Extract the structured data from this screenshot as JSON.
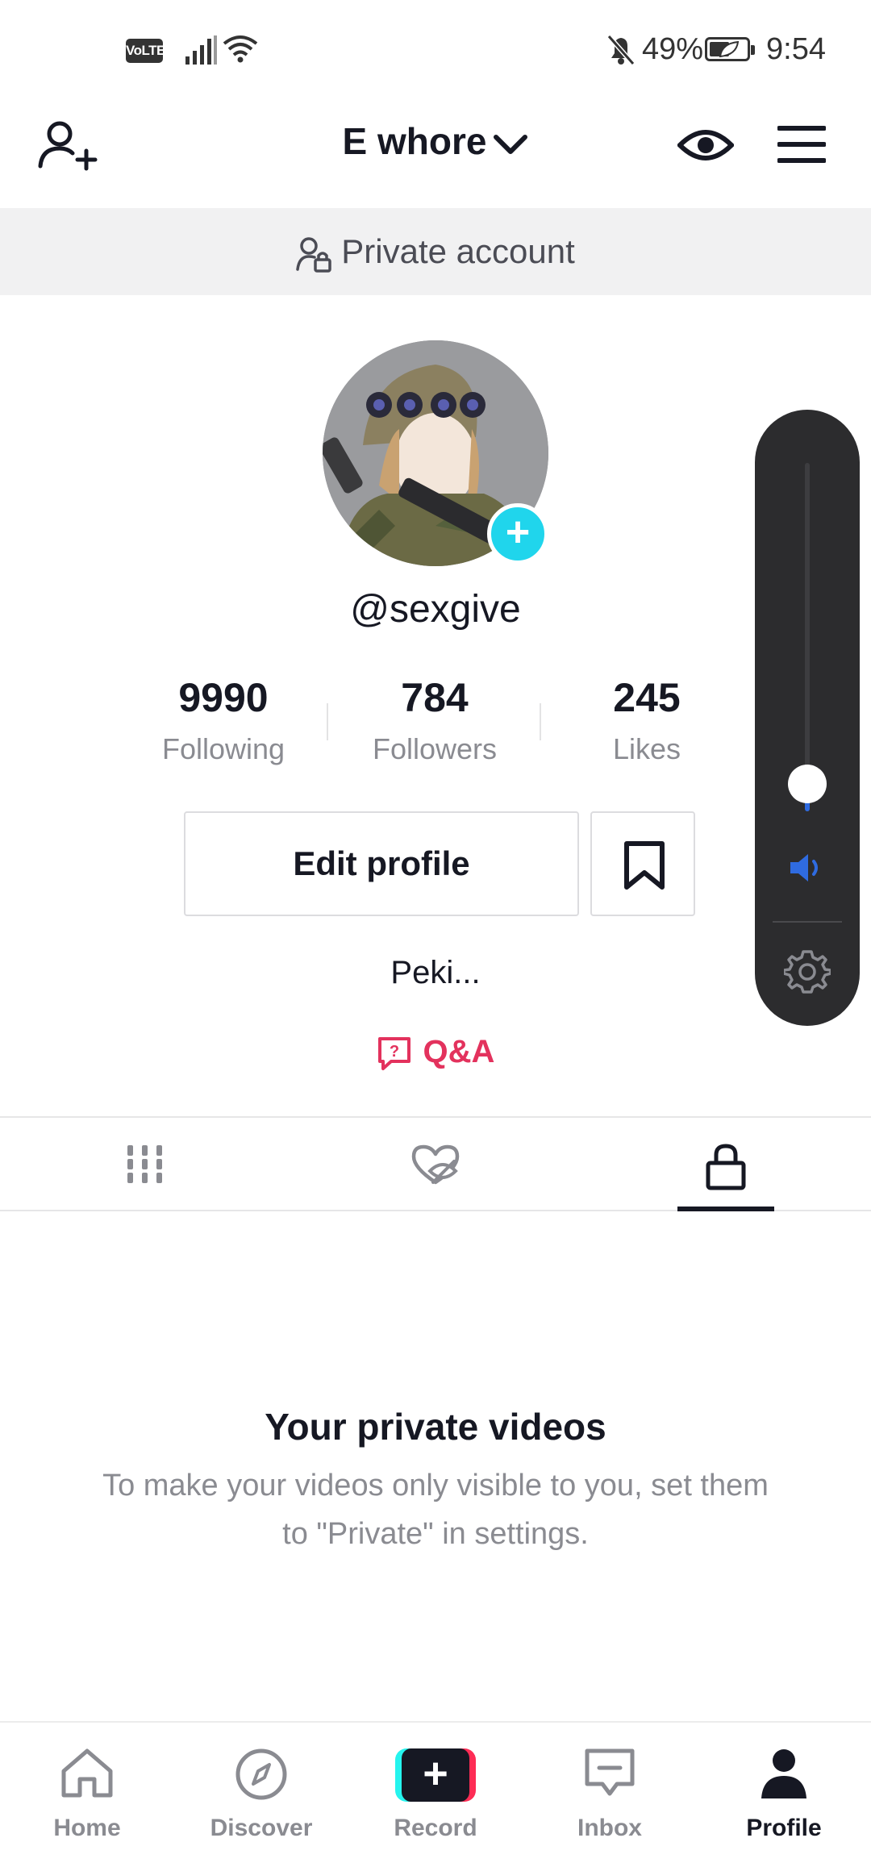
{
  "status_bar": {
    "network_badge": "VoLTE",
    "battery_percent": "49%",
    "time": "9:54",
    "icons": [
      "signal-icon",
      "wifi-icon",
      "notifications-off-icon",
      "battery-icon"
    ]
  },
  "header": {
    "account_name": "E whore",
    "icons": [
      "add-user-icon",
      "chevron-down-icon",
      "eye-icon",
      "menu-icon"
    ]
  },
  "private_banner": {
    "text": "Private account"
  },
  "profile": {
    "handle": "@sexgive",
    "stats": [
      {
        "value": "9990",
        "label": "Following"
      },
      {
        "value": "784",
        "label": "Followers"
      },
      {
        "value": "245",
        "label": "Likes"
      }
    ],
    "edit_button": "Edit profile",
    "bio": "Peki...",
    "qa_label": "Q&A"
  },
  "tabs": {
    "items": [
      "videos-grid-icon",
      "liked-hidden-icon",
      "lock-icon"
    ],
    "active_index": 2
  },
  "empty_state": {
    "title": "Your private videos",
    "description": "To make your videos only visible to you, set them to \"Private\" in settings."
  },
  "volume_panel": {
    "level": 0.05,
    "accent_color": "#2f6be0"
  },
  "bottom_nav": {
    "items": [
      {
        "label": "Home",
        "icon": "home-icon"
      },
      {
        "label": "Discover",
        "icon": "compass-icon"
      },
      {
        "label": "Record",
        "icon": "plus-icon"
      },
      {
        "label": "Inbox",
        "icon": "inbox-icon"
      },
      {
        "label": "Profile",
        "icon": "person-icon"
      }
    ],
    "active_index": 4
  },
  "colors": {
    "text_primary": "#161823",
    "text_secondary": "#8a8b91",
    "qa_accent": "#e3325d",
    "avatar_badge": "#20d5ec",
    "record_cyan": "#25f4ee",
    "record_red": "#fe2c55"
  }
}
